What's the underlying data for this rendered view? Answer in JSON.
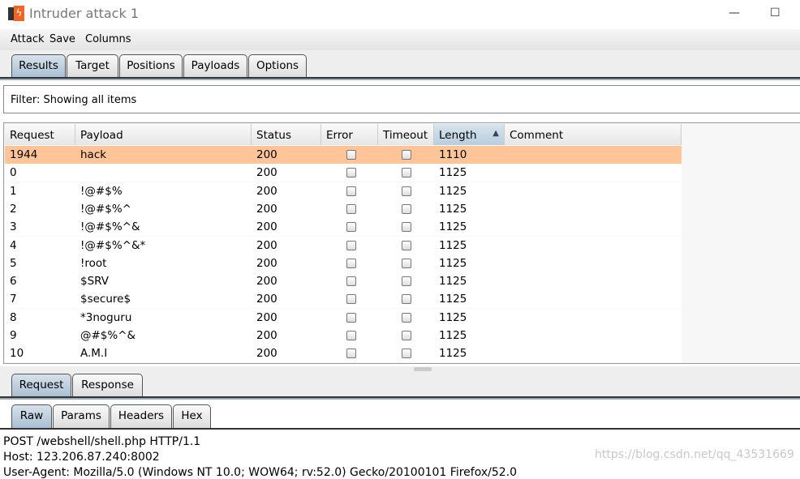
{
  "window": {
    "title": "Intruder attack 1",
    "minimize": "—",
    "maximize": "☐"
  },
  "menu": [
    "Attack",
    "Save",
    "Columns"
  ],
  "tabs": [
    "Results",
    "Target",
    "Positions",
    "Payloads",
    "Options"
  ],
  "filter": "Filter: Showing all items",
  "table": {
    "columns": [
      "Request",
      "Payload",
      "Status",
      "Error",
      "Timeout",
      "Length",
      "Comment"
    ],
    "sort_column": "Length",
    "sort_direction": "ascending",
    "rows": [
      {
        "request": "1944",
        "payload": "hack",
        "status": "200",
        "error": false,
        "timeout": false,
        "length": "1110",
        "comment": "",
        "selected": true
      },
      {
        "request": "0",
        "payload": "",
        "status": "200",
        "error": false,
        "timeout": false,
        "length": "1125",
        "comment": ""
      },
      {
        "request": "1",
        "payload": "!@#$%",
        "status": "200",
        "error": false,
        "timeout": false,
        "length": "1125",
        "comment": ""
      },
      {
        "request": "2",
        "payload": "!@#$%^",
        "status": "200",
        "error": false,
        "timeout": false,
        "length": "1125",
        "comment": ""
      },
      {
        "request": "3",
        "payload": "!@#$%^&",
        "status": "200",
        "error": false,
        "timeout": false,
        "length": "1125",
        "comment": ""
      },
      {
        "request": "4",
        "payload": "!@#$%^&*",
        "status": "200",
        "error": false,
        "timeout": false,
        "length": "1125",
        "comment": ""
      },
      {
        "request": "5",
        "payload": "!root",
        "status": "200",
        "error": false,
        "timeout": false,
        "length": "1125",
        "comment": ""
      },
      {
        "request": "6",
        "payload": "$SRV",
        "status": "200",
        "error": false,
        "timeout": false,
        "length": "1125",
        "comment": ""
      },
      {
        "request": "7",
        "payload": "$secure$",
        "status": "200",
        "error": false,
        "timeout": false,
        "length": "1125",
        "comment": ""
      },
      {
        "request": "8",
        "payload": "*3noguru",
        "status": "200",
        "error": false,
        "timeout": false,
        "length": "1125",
        "comment": ""
      },
      {
        "request": "9",
        "payload": "@#$%^&",
        "status": "200",
        "error": false,
        "timeout": false,
        "length": "1125",
        "comment": ""
      },
      {
        "request": "10",
        "payload": "A.M.I",
        "status": "200",
        "error": false,
        "timeout": false,
        "length": "1125",
        "comment": ""
      }
    ]
  },
  "detail_tabs": [
    "Request",
    "Response"
  ],
  "view_tabs": [
    "Raw",
    "Params",
    "Headers",
    "Hex"
  ],
  "request_lines": [
    "POST /webshell/shell.php HTTP/1.1",
    "Host: 123.206.87.240:8002",
    "User-Agent: Mozilla/5.0 (Windows NT 10.0; WOW64; rv:52.0) Gecko/20100101 Firefox/52.0"
  ],
  "watermark": "https://blog.csdn.net/qq_43531669",
  "colors": {
    "selected_row": "#ffc599",
    "active_tab": "#a8bfd2",
    "logo": "#f26522"
  }
}
